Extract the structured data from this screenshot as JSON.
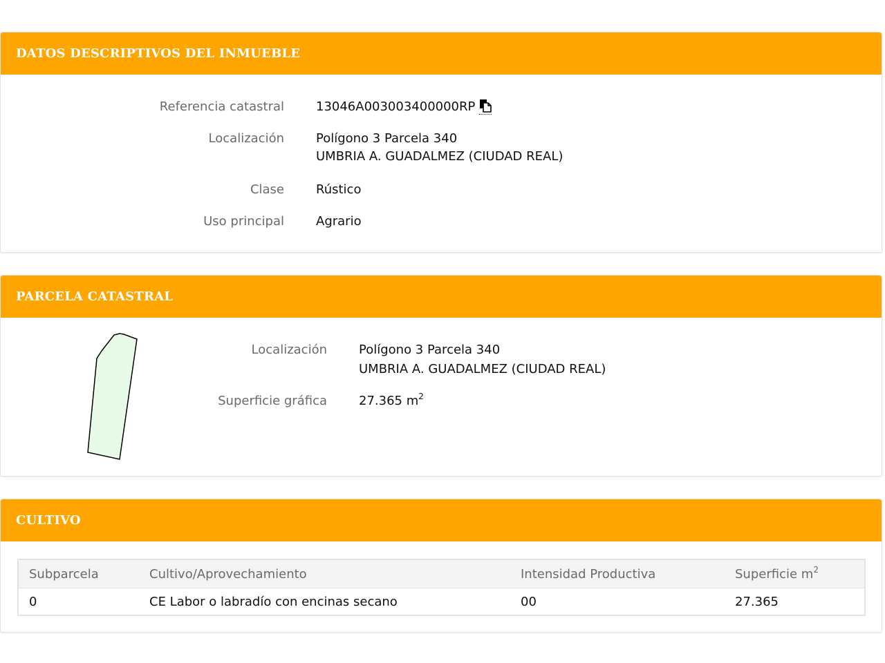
{
  "descriptivos": {
    "title": "DATOS DESCRIPTIVOS DEL INMUEBLE",
    "referencia_label": "Referencia catastral",
    "referencia_value": "13046A003003400000RP",
    "localizacion_label": "Localización",
    "localizacion_line1": "Polígono 3 Parcela 340",
    "localizacion_line2": "UMBRIA A. GUADALMEZ (CIUDAD REAL)",
    "clase_label": "Clase",
    "clase_value": "Rústico",
    "uso_label": "Uso principal",
    "uso_value": "Agrario",
    "copy_icon": "copy-icon"
  },
  "parcela": {
    "title": "PARCELA CATASTRAL",
    "localizacion_label": "Localización",
    "localizacion_line1": "Polígono 3 Parcela 340",
    "localizacion_line2": "UMBRIA A. GUADALMEZ (CIUDAD REAL)",
    "superficie_label": "Superficie gráfica",
    "superficie_value": "27.365 m",
    "superficie_unit_sup": "2",
    "shape_fill": "#e8fbe8",
    "shape_stroke": "#000000"
  },
  "cultivo": {
    "title": "CULTIVO",
    "headers": {
      "subparcela": "Subparcela",
      "cultivo": "Cultivo/Aprovechamiento",
      "intensidad": "Intensidad Productiva",
      "superficie": "Superficie m",
      "superficie_sup": "2"
    },
    "rows": [
      {
        "subparcela": "0",
        "cultivo": "CE Labor o labradío con encinas secano",
        "intensidad": "00",
        "superficie": "27.365"
      }
    ]
  },
  "colors": {
    "header_orange": "#ffa500",
    "label_gray": "#6a6a6a"
  }
}
